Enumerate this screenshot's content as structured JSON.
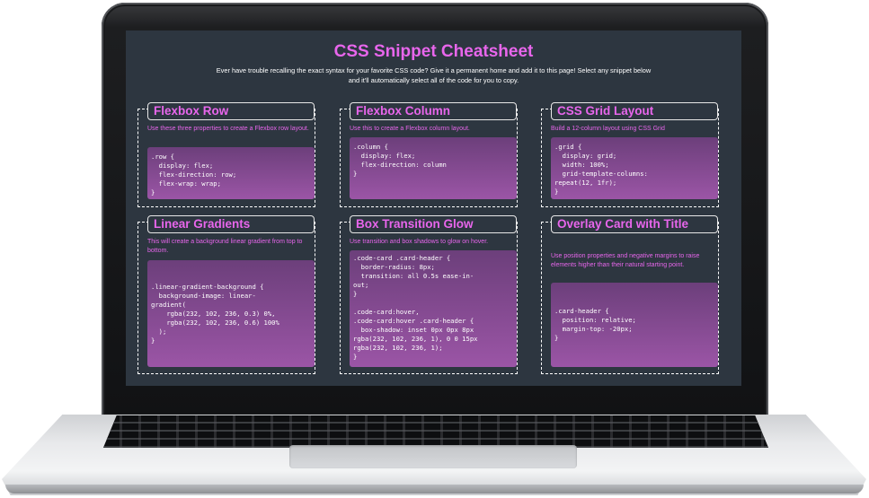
{
  "page": {
    "title": "CSS Snippet Cheatsheet",
    "intro": "Ever have trouble recalling the exact syntax for your favorite CSS code? Give it a permanent home and add it to this page! Select any snippet below and it'll automatically select all of the code for you to copy."
  },
  "colors": {
    "accent": "#e866ec",
    "background": "#2d3640",
    "code_gradient_top": "#6c3f7b",
    "code_gradient_bottom": "#9b55a6"
  },
  "cards": [
    {
      "title": "Flexbox Row",
      "description": "Use these three properties to create a Flexbox row layout.",
      "code": ".row {\n  display: flex;\n  flex-direction: row;\n  flex-wrap: wrap;\n}"
    },
    {
      "title": "Flexbox Column",
      "description": "Use this to create a Flexbox column layout.",
      "code": ".column {\n  display: flex;\n  flex-direction: column\n}"
    },
    {
      "title": "CSS Grid Layout",
      "description": "Build a 12-column layout using CSS Grid",
      "code": ".grid {\n  display: grid;\n  width: 100%;\n  grid-template-columns:\nrepeat(12, 1fr);\n}"
    },
    {
      "title": "Linear Gradients",
      "description": "This will create a background linear gradient from top to bottom.",
      "code": ".linear-gradient-background {\n  background-image: linear-\ngradient(\n    rgba(232, 102, 236, 0.3) 0%,\n    rgba(232, 102, 236, 0.6) 100%\n  );\n}"
    },
    {
      "title": "Box Transition Glow",
      "description": "Use transition and box shadows to glow on hover.",
      "code": ".code-card .card-header {\n  border-radius: 8px;\n  transition: all 0.5s ease-in-\nout;\n}\n\n.code-card:hover,\n.code-card:hover .card-header {\n  box-shadow: inset 0px 0px 8px\nrgba(232, 102, 236, 1), 0 0 15px\nrgba(232, 102, 236, 1);\n}"
    },
    {
      "title": "Overlay Card with Title",
      "description": "Use position properties and negative margins to raise elements higher than their natural starting point.",
      "code": ".card-header {\n  position: relative;\n  margin-top: -20px;\n}"
    }
  ]
}
